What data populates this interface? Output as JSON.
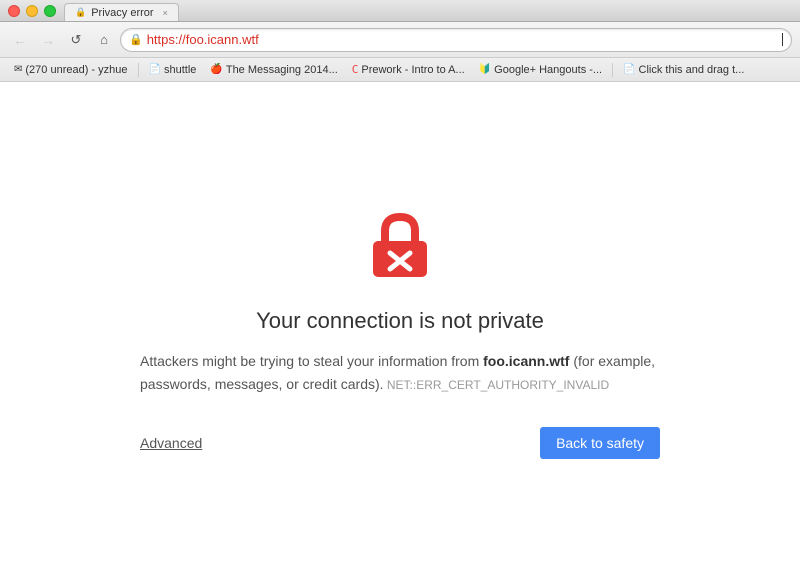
{
  "window": {
    "title": "Privacy error",
    "tab_close": "×"
  },
  "nav": {
    "back_label": "←",
    "forward_label": "→",
    "reload_label": "↺",
    "home_label": "⌂",
    "address": "https://foo.icann.wtf"
  },
  "bookmarks": [
    {
      "id": "bm-email",
      "icon": "✉",
      "label": "(270 unread) - yzhue"
    },
    {
      "id": "bm-shuttle",
      "icon": "📄",
      "label": "shuttle"
    },
    {
      "id": "bm-messaging",
      "icon": "🍎",
      "label": "The Messaging 2014..."
    },
    {
      "id": "bm-prework",
      "icon": "C",
      "label": "Prework - Intro to A..."
    },
    {
      "id": "bm-hangouts",
      "icon": "🔒",
      "label": "Google+ Hangouts -..."
    },
    {
      "id": "bm-drag",
      "icon": "📄",
      "label": "Click this and drag t..."
    }
  ],
  "error_page": {
    "title": "Your connection is not private",
    "description_before": "Attackers might be trying to steal your information from ",
    "domain": "foo.icann.wtf",
    "description_middle": " (for example, passwords, messages, or credit cards).",
    "error_code": " NET::ERR_CERT_AUTHORITY_INVALID",
    "advanced_label": "Advanced",
    "back_to_safety_label": "Back to safety"
  }
}
